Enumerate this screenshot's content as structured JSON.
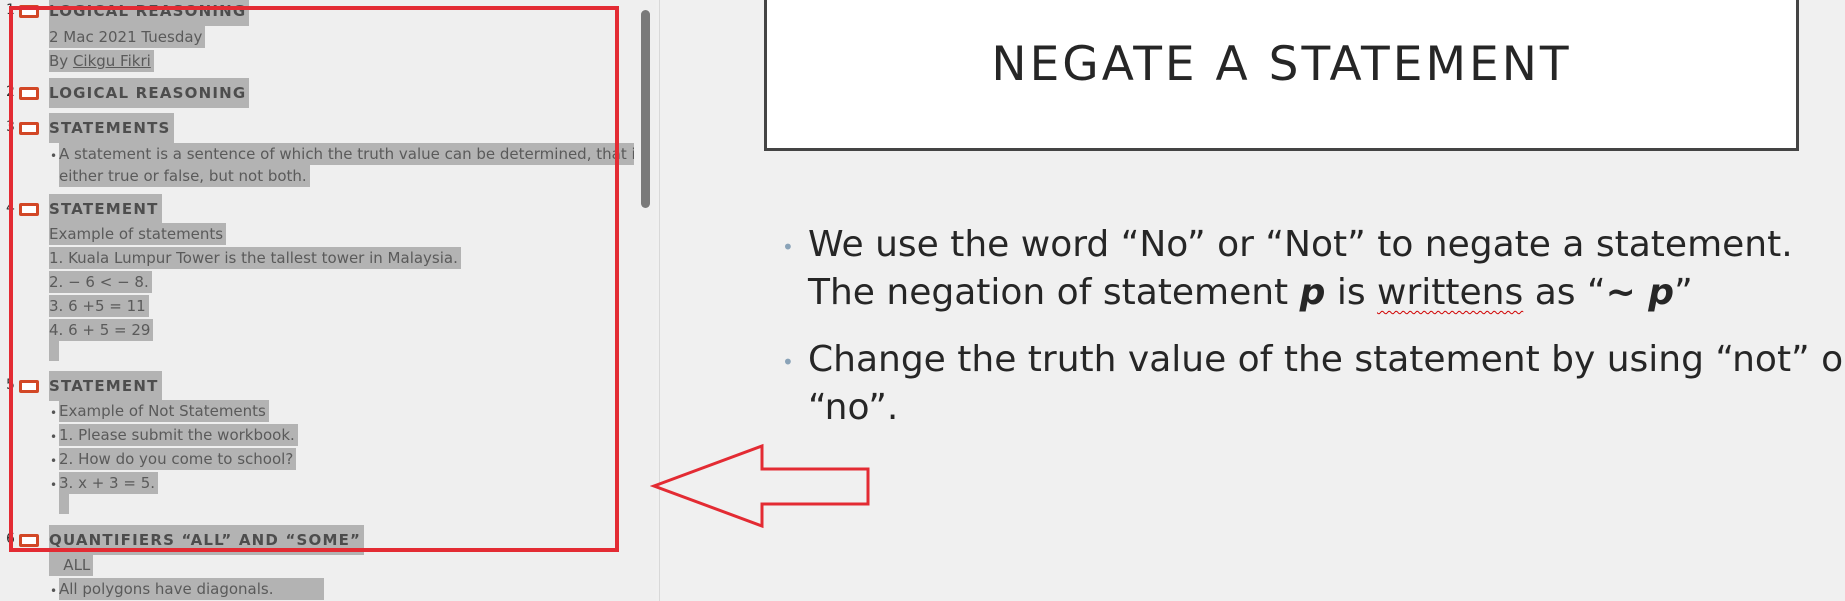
{
  "outline": {
    "slides": [
      {
        "num": "1",
        "title": "LOGICAL REASONING",
        "lines": [
          "2 Mac 2021 Tuesday",
          "By ",
          "Cikgu Fikri"
        ]
      },
      {
        "num": "2",
        "title": "LOGICAL REASONING"
      },
      {
        "num": "3",
        "title": "STATEMENTS",
        "bullet_text_1": "A statement is a sentence of which the truth value can be determined, that is",
        "bullet_text_2": "either true or false, but not both."
      },
      {
        "num": "4",
        "title": "STATEMENT",
        "lines": [
          "Example of statements",
          "1. Kuala Lumpur Tower is the tallest tower in Malaysia.",
          "2.   − 6 < − 8.",
          "3.   6 +5 = 11",
          "4.  6 + 5 = 29"
        ]
      },
      {
        "num": "5",
        "title": "STATEMENT",
        "bullets": [
          "Example of Not Statements",
          "1. Please submit the workbook.",
          "2. How do you come to school?",
          "3. x + 3 = 5."
        ]
      },
      {
        "num": "6",
        "title": "QUANTIFIERS “ALL” AND “SOME”",
        "lines": [
          "   ALL"
        ],
        "bullets": [
          "All polygons have diagonals."
        ]
      }
    ]
  },
  "slide": {
    "title": "NEGATE A STATEMENT",
    "bullet1_line1": "We use the word “No” or “Not” to negate a statement.",
    "bullet1_line2_a": "The negation of statement ",
    "bullet1_line2_p": "p",
    "bullet1_line2_b": " is ",
    "bullet1_line2_err": "writtens",
    "bullet1_line2_c": " as “",
    "bullet1_line2_neg": "~ p",
    "bullet1_line2_d": "”",
    "bullet2_line1": "Change the truth value of the statement by using “not” or",
    "bullet2_line2": "“no”."
  },
  "colors": {
    "annotation": "#e32b33",
    "slide_icon": "#d24726",
    "selection": "#b3b3b3"
  }
}
